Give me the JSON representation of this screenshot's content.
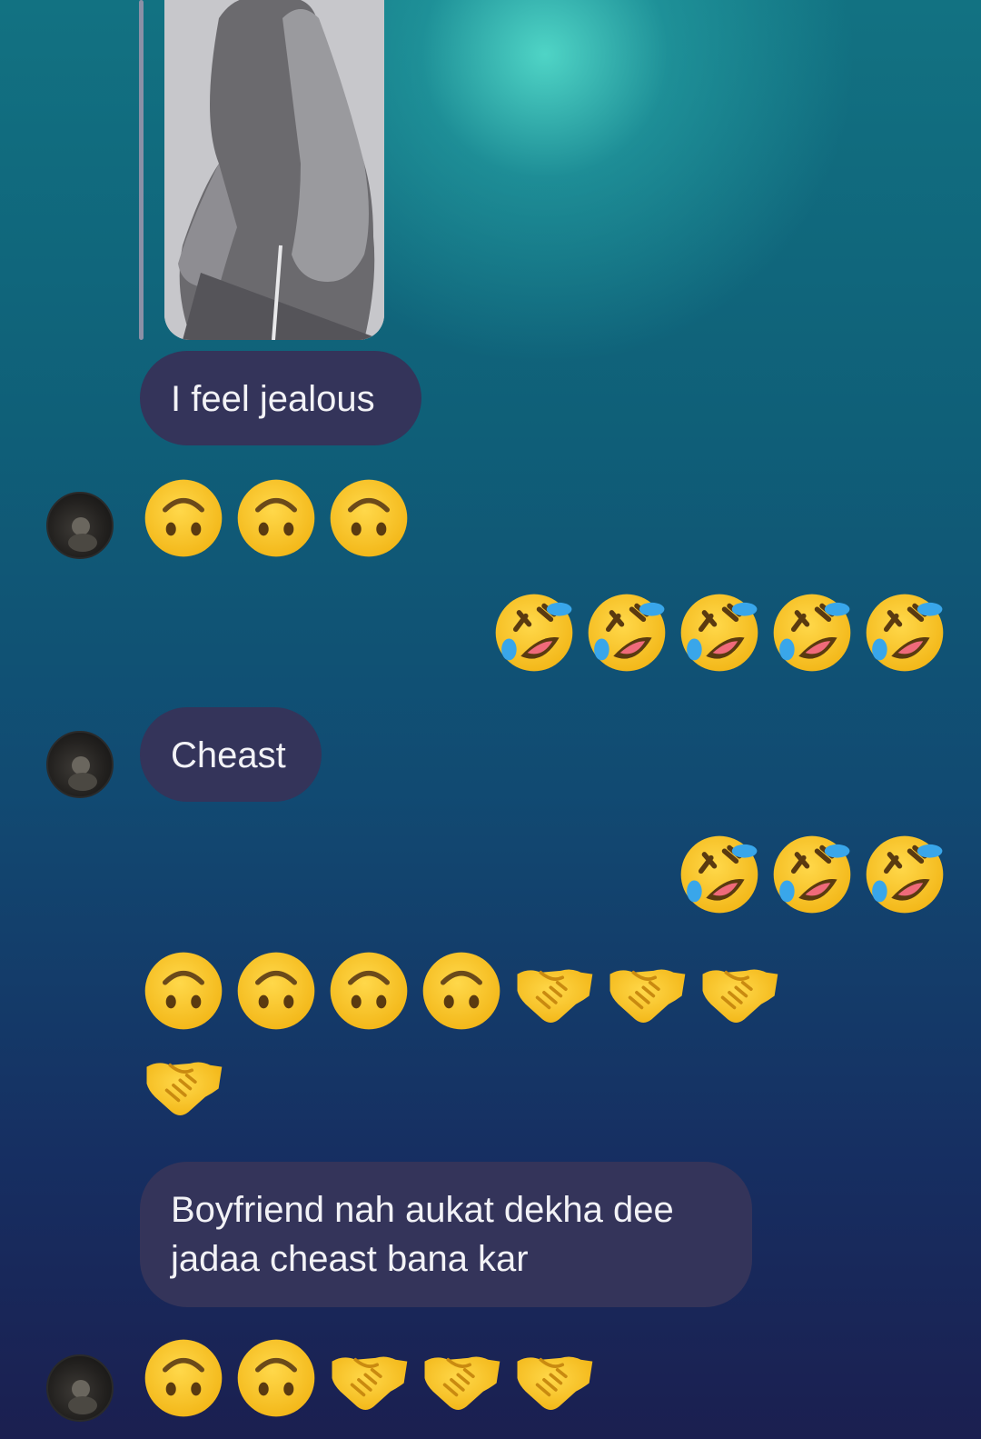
{
  "messages": {
    "m1_text": "I feel jealous",
    "m2_text": "Cheast",
    "m3_text": "Boyfriend nah aukat dekha dee jadaa cheast bana kar"
  },
  "emoji_groups": {
    "received_1": [
      "upside-down-face-icon",
      "upside-down-face-icon",
      "upside-down-face-icon"
    ],
    "sent_1": [
      "rofl-icon",
      "rofl-icon",
      "rofl-icon",
      "rofl-icon",
      "rofl-icon"
    ],
    "sent_2": [
      "rofl-icon",
      "rofl-icon",
      "rofl-icon"
    ],
    "received_2": [
      "upside-down-face-icon",
      "upside-down-face-icon",
      "upside-down-face-icon",
      "upside-down-face-icon",
      "handshake-icon",
      "handshake-icon",
      "handshake-icon",
      "handshake-icon"
    ],
    "received_3": [
      "upside-down-face-icon",
      "upside-down-face-icon",
      "handshake-icon",
      "handshake-icon",
      "handshake-icon"
    ]
  },
  "colors": {
    "bubble": "#34345a",
    "emoji_yellow": "#f9c41c"
  }
}
